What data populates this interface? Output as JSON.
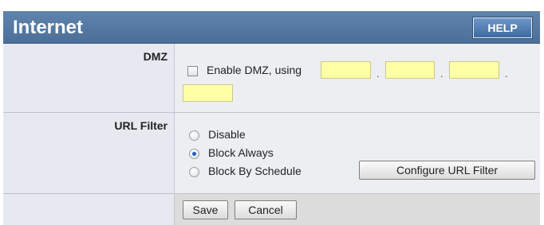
{
  "header": {
    "title": "Internet",
    "help_label": "HELP"
  },
  "dmz": {
    "label": "DMZ",
    "checkbox_label": "Enable DMZ, using",
    "ip_octets": [
      "",
      "",
      "",
      ""
    ],
    "separator": "."
  },
  "url_filter": {
    "label": "URL Filter",
    "options": [
      {
        "label": "Disable",
        "selected": false
      },
      {
        "label": "Block Always",
        "selected": true
      },
      {
        "label": "Block By Schedule",
        "selected": false
      }
    ],
    "configure_label": "Configure URL Filter"
  },
  "actions": {
    "save_label": "Save",
    "cancel_label": "Cancel"
  },
  "colors": {
    "title_bar": "#5278a3",
    "input_fill": "#ffffa6",
    "panel_bg": "#dcdcdc"
  }
}
